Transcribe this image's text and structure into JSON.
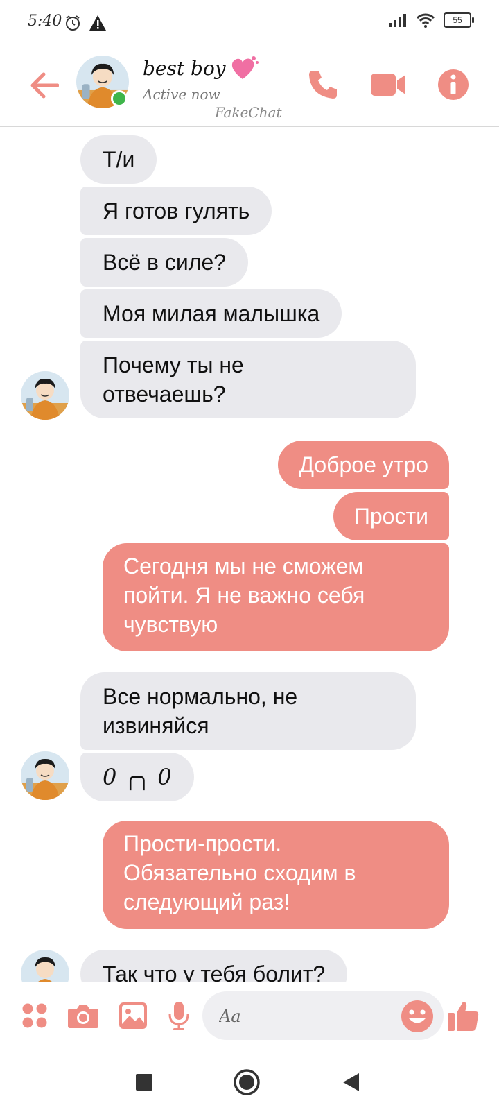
{
  "status_bar": {
    "time": "5:40",
    "battery": "55"
  },
  "header": {
    "contact_name": "best boy",
    "status": "Active now",
    "watermark": "FakeChat"
  },
  "messages": [
    {
      "side": "in",
      "text": "Т/и"
    },
    {
      "side": "in",
      "text": "Я готов гулять"
    },
    {
      "side": "in",
      "text": "Всё в силе?"
    },
    {
      "side": "in",
      "text": "Моя милая малышка"
    },
    {
      "side": "in",
      "lines": [
        "Почему ты не",
        "отвечаешь?"
      ]
    },
    {
      "side": "out",
      "text": "Доброе утро"
    },
    {
      "side": "out",
      "text": "Прости"
    },
    {
      "side": "out",
      "lines": [
        "Сегодня мы не сможем",
        "пойти. Я не важно себя",
        "чувствую"
      ]
    },
    {
      "side": "in",
      "lines": [
        "Все нормально, не",
        "извиняйся"
      ]
    },
    {
      "side": "in",
      "text": "0 ╭╮ 0"
    },
    {
      "side": "out",
      "lines": [
        "Прости-прости.",
        "Обязательно сходим в",
        "следующий раз!"
      ]
    },
    {
      "side": "in",
      "text": "Так что у тебя болит?"
    }
  ],
  "composer": {
    "placeholder": "Aa"
  },
  "icons": {
    "back": "arrow-left-icon",
    "call": "phone-icon",
    "video": "video-camera-icon",
    "info": "info-icon",
    "menu": "four-dots-icon",
    "camera": "camera-icon",
    "gallery": "image-icon",
    "mic": "microphone-icon",
    "emoji": "smiley-icon",
    "like": "thumbs-up-icon"
  },
  "colors": {
    "accent": "#ef8d84",
    "incoming_bubble": "#e9e9ed",
    "online": "#3fb54a"
  }
}
